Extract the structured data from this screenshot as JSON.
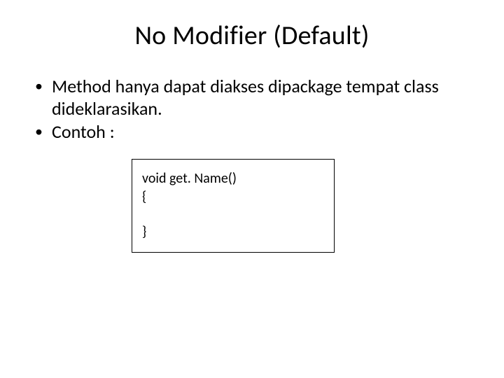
{
  "title": "No Modifier (Default)",
  "bullets": {
    "item1": "Method hanya dapat diakses dipackage tempat class dideklarasikan.",
    "item2": "Contoh :"
  },
  "code": {
    "line1": "void get. Name()",
    "line2": "{",
    "line3": "}"
  }
}
